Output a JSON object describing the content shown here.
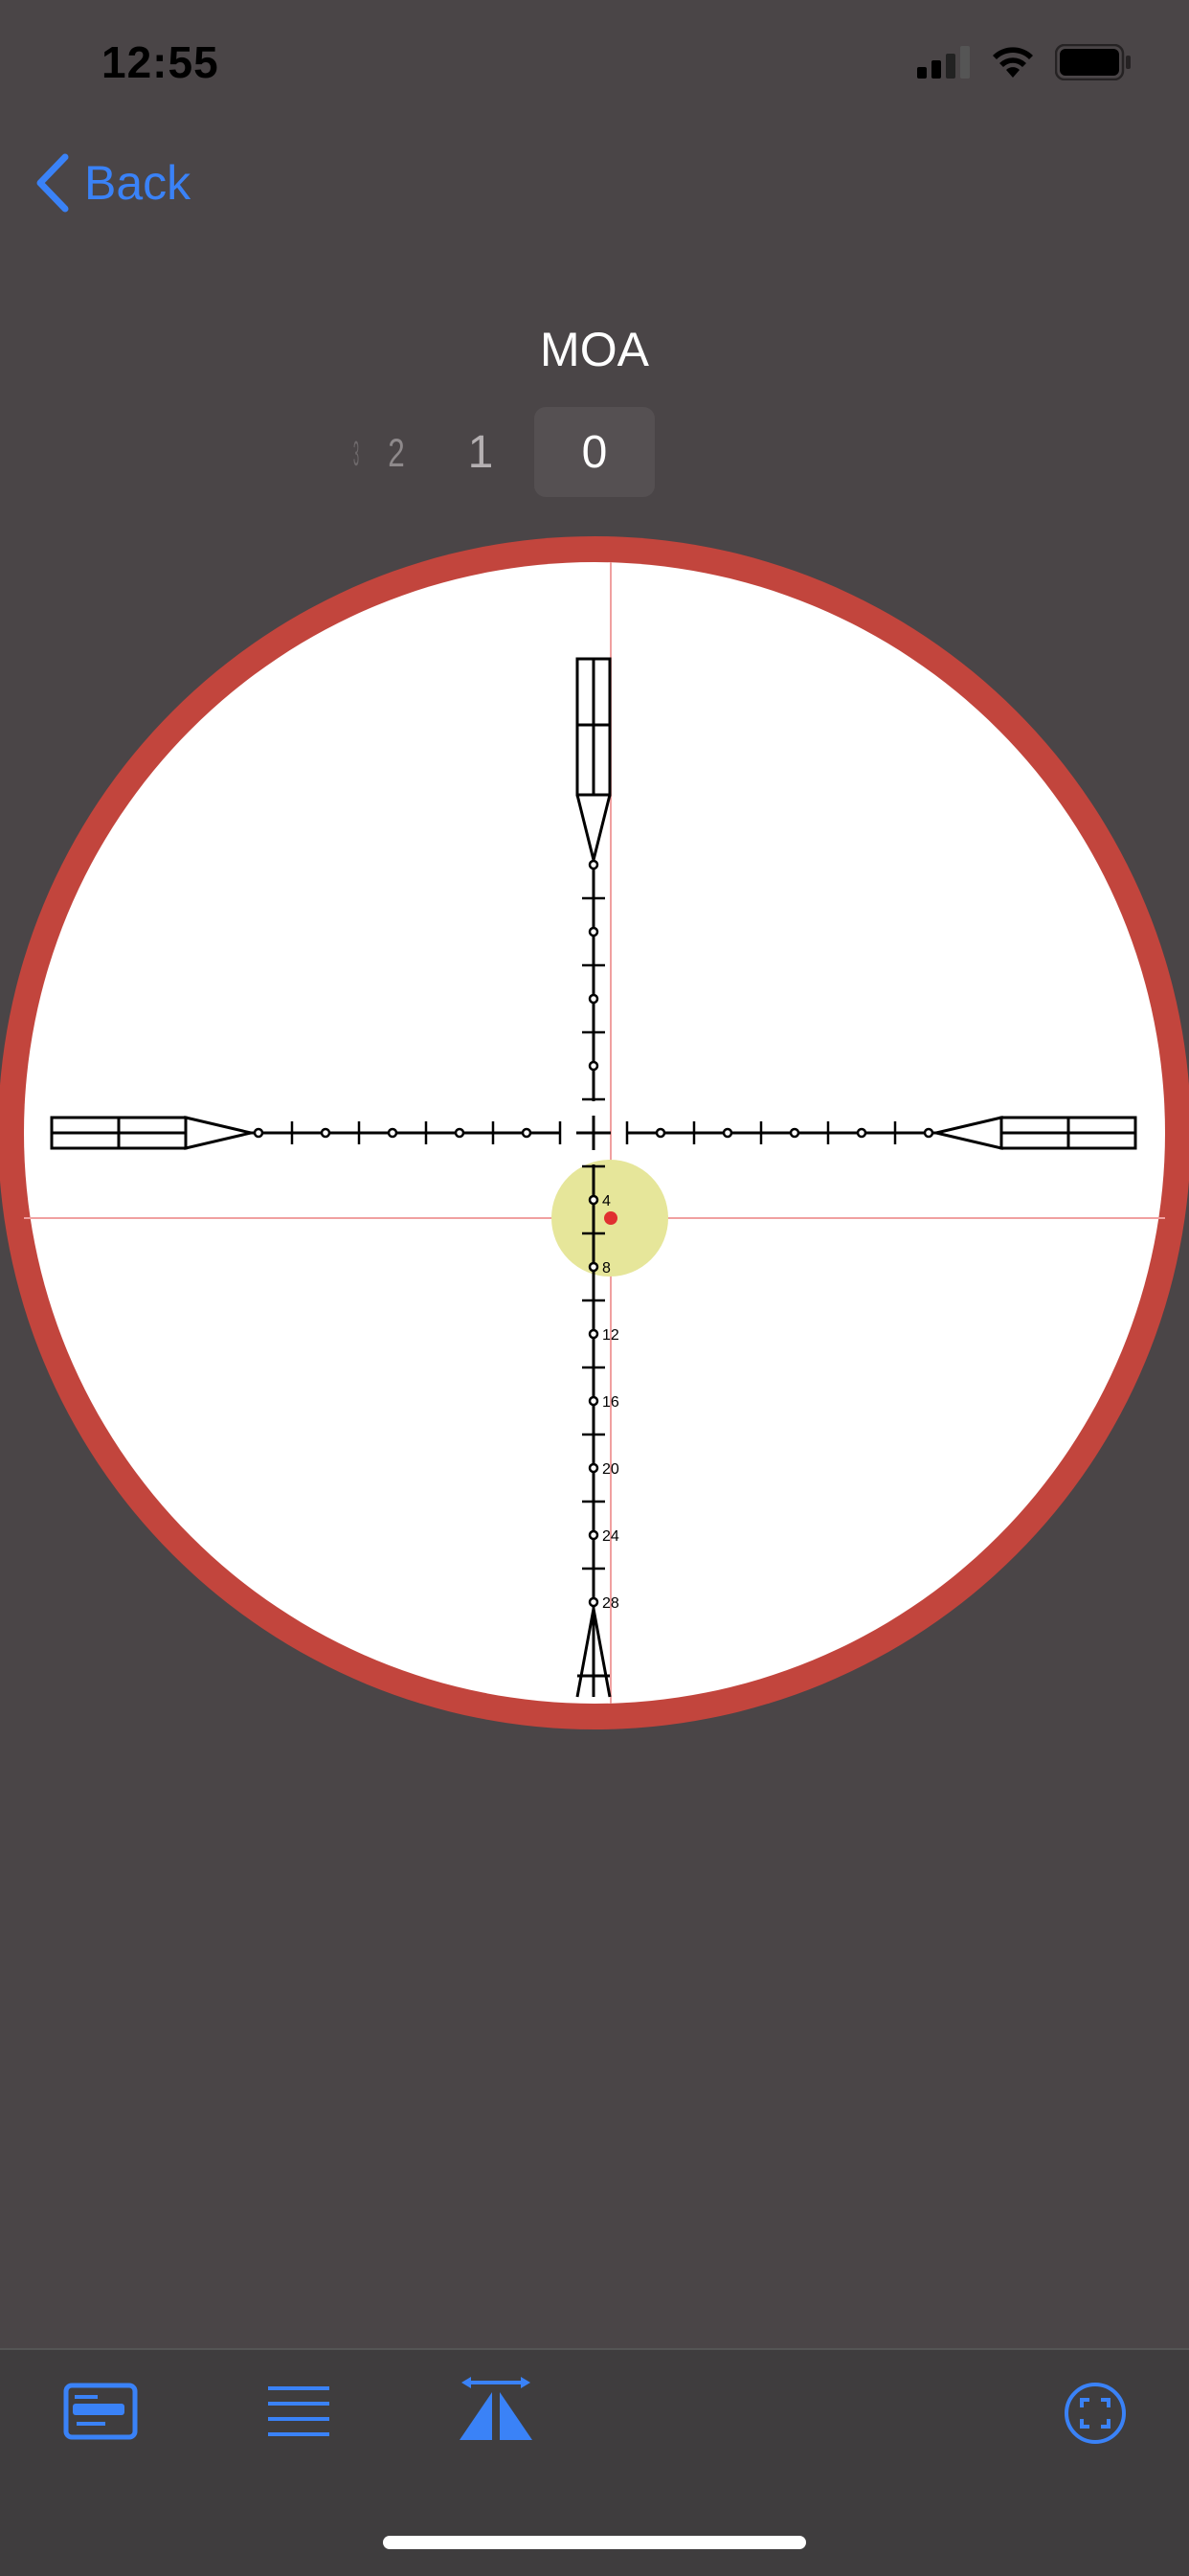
{
  "status_bar": {
    "time": "12:55",
    "icons": [
      "cellular-signal-icon",
      "wifi-icon",
      "battery-icon"
    ]
  },
  "nav": {
    "back_label": "Back"
  },
  "unit": {
    "title": "MOA"
  },
  "picker": {
    "values": [
      "0",
      "1",
      "2",
      "3"
    ],
    "selected": "0"
  },
  "reticle": {
    "elevation_labels": [
      "4",
      "8",
      "12",
      "16",
      "20",
      "24",
      "28"
    ],
    "impact_marker": "red-dot-on-yellow-circle"
  },
  "colors": {
    "background": "#4a4547",
    "accent": "#3a82f7",
    "scope_ring": "#c2453d",
    "impact_circle": "#e6e69a",
    "impact_dot": "#e03030",
    "crosshair_guide": "#f0a0a0"
  },
  "toolbar": {
    "items": [
      "card-icon",
      "menu-list-icon",
      "reticle-range-icon",
      "fullscreen-icon"
    ]
  }
}
